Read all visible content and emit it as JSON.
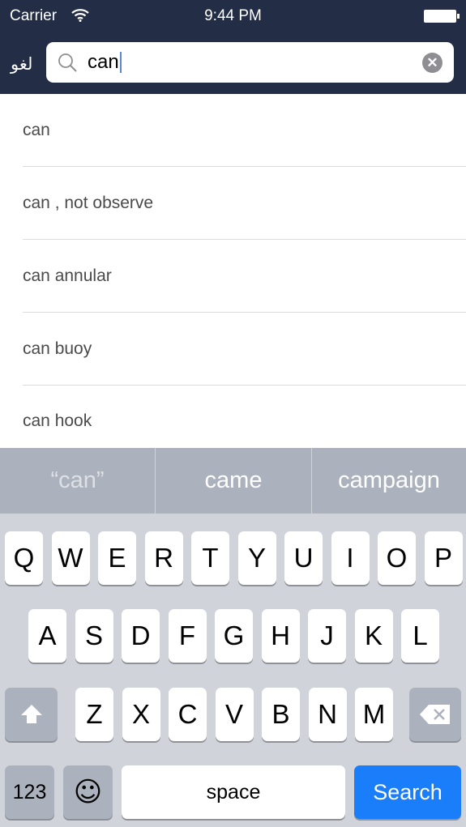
{
  "status_bar": {
    "carrier": "Carrier",
    "time": "9:44 PM"
  },
  "nav": {
    "app_label": "لغو",
    "search_value": "can"
  },
  "results": [
    "can",
    "can , not observe",
    "can annular",
    "can buoy",
    "can hook"
  ],
  "suggestions": [
    "“can”",
    "came",
    "campaign"
  ],
  "keyboard": {
    "row1": [
      "Q",
      "W",
      "E",
      "R",
      "T",
      "Y",
      "U",
      "I",
      "O",
      "P"
    ],
    "row2": [
      "A",
      "S",
      "D",
      "F",
      "G",
      "H",
      "J",
      "K",
      "L"
    ],
    "row3": [
      "Z",
      "X",
      "C",
      "V",
      "B",
      "N",
      "M"
    ],
    "numbers_label": "123",
    "space_label": "space",
    "search_label": "Search"
  },
  "colors": {
    "bar": "#232d45",
    "accent": "#1a7dfa"
  }
}
